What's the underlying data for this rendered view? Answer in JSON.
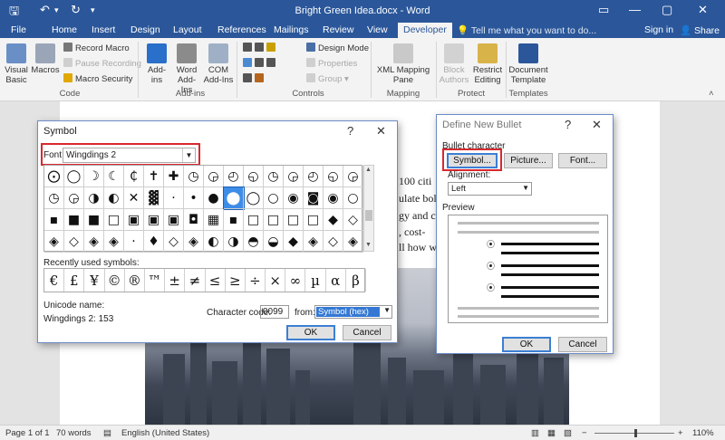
{
  "window": {
    "title": "Bright Green Idea.docx - Word"
  },
  "tabs": [
    "File",
    "Home",
    "Insert",
    "Design",
    "Layout",
    "References",
    "Mailings",
    "Review",
    "View",
    "Developer"
  ],
  "active_tab": "Developer",
  "tell_me": "Tell me what you want to do...",
  "sign_in": "Sign in",
  "share": "Share",
  "ribbon": {
    "code": {
      "visual_basic": "Visual Basic",
      "macros": "Macros",
      "record_macro": "Record Macro",
      "pause_recording": "Pause Recording",
      "macro_security": "Macro Security",
      "label": "Code"
    },
    "addins": {
      "addins": "Add-ins",
      "word_addins": "Word Add-Ins",
      "com_addins": "COM Add-Ins",
      "label": "Add-ins"
    },
    "controls": {
      "design_mode": "Design Mode",
      "properties": "Properties",
      "group": "Group",
      "label": "Controls"
    },
    "mapping": {
      "xml_mapping": "XML Mapping Pane",
      "label": "Mapping"
    },
    "protect": {
      "block_authors": "Block Authors",
      "restrict_editing": "Restrict Editing",
      "label": "Protect"
    },
    "templates": {
      "document_template": "Document Template",
      "label": "Templates"
    }
  },
  "document": {
    "lines": [
      "100 citi",
      "ulate bol",
      "gy and c",
      ", cost-",
      "ll how w"
    ]
  },
  "symbol_dialog": {
    "title": "Symbol",
    "help": "?",
    "close": "✕",
    "font_label": "Font:",
    "font_value": "Wingdings 2",
    "symbols": [
      [
        "⨀",
        "◯",
        "☽",
        "☾",
        "₵",
        "✝",
        "✚",
        "◷",
        "◶",
        "◴",
        "◵",
        "◷",
        "◶",
        "◴",
        "◵",
        "◶"
      ],
      [
        "◷",
        "◶",
        "◑",
        "◐",
        "✕",
        "▓",
        "·",
        "•",
        "●",
        "⬤",
        "◯",
        "○",
        "◉",
        "◙",
        "◉",
        "○"
      ],
      [
        "▪",
        "■",
        "■",
        "□",
        "▣",
        "▣",
        "▣",
        "◘",
        "▦",
        "▪",
        "□",
        "□",
        "□",
        "□",
        "◆",
        "◇"
      ],
      [
        "◈",
        "◇",
        "◈",
        "◈",
        "·",
        "♦",
        "◇",
        "◈",
        "◐",
        "◑",
        "◓",
        "◒",
        "◆",
        "◈",
        "◇",
        "◈"
      ]
    ],
    "selected_index": [
      1,
      9
    ],
    "recent_label": "Recently used symbols:",
    "recent_symbols": [
      "€",
      "£",
      "¥",
      "©",
      "®",
      "™",
      "±",
      "≠",
      "≤",
      "≥",
      "÷",
      "×",
      "∞",
      "µ",
      "α",
      "β"
    ],
    "unicode_name_label": "Unicode name:",
    "unicode_name_value": "Wingdings 2: 153",
    "char_code_label": "Character code:",
    "char_code_value": "0099",
    "from_label": "from:",
    "from_value": "Symbol (hex)",
    "ok": "OK",
    "cancel": "Cancel"
  },
  "bullet_dialog": {
    "title": "Define New Bullet",
    "help": "?",
    "close": "✕",
    "bullet_character_label": "Bullet character",
    "symbol_button": "Symbol...",
    "picture_button": "Picture...",
    "font_button": "Font...",
    "alignment_label": "Alignment:",
    "alignment_value": "Left",
    "preview_label": "Preview",
    "bullet_glyph": "⦿",
    "ok": "OK",
    "cancel": "Cancel"
  },
  "status": {
    "page": "Page 1 of 1",
    "words": "70 words",
    "language": "English (United States)",
    "zoom": "110%"
  },
  "colors": {
    "accent": "#2b579a",
    "highlight_red": "#d9282f",
    "selected_cell": "#3d8ce8"
  }
}
